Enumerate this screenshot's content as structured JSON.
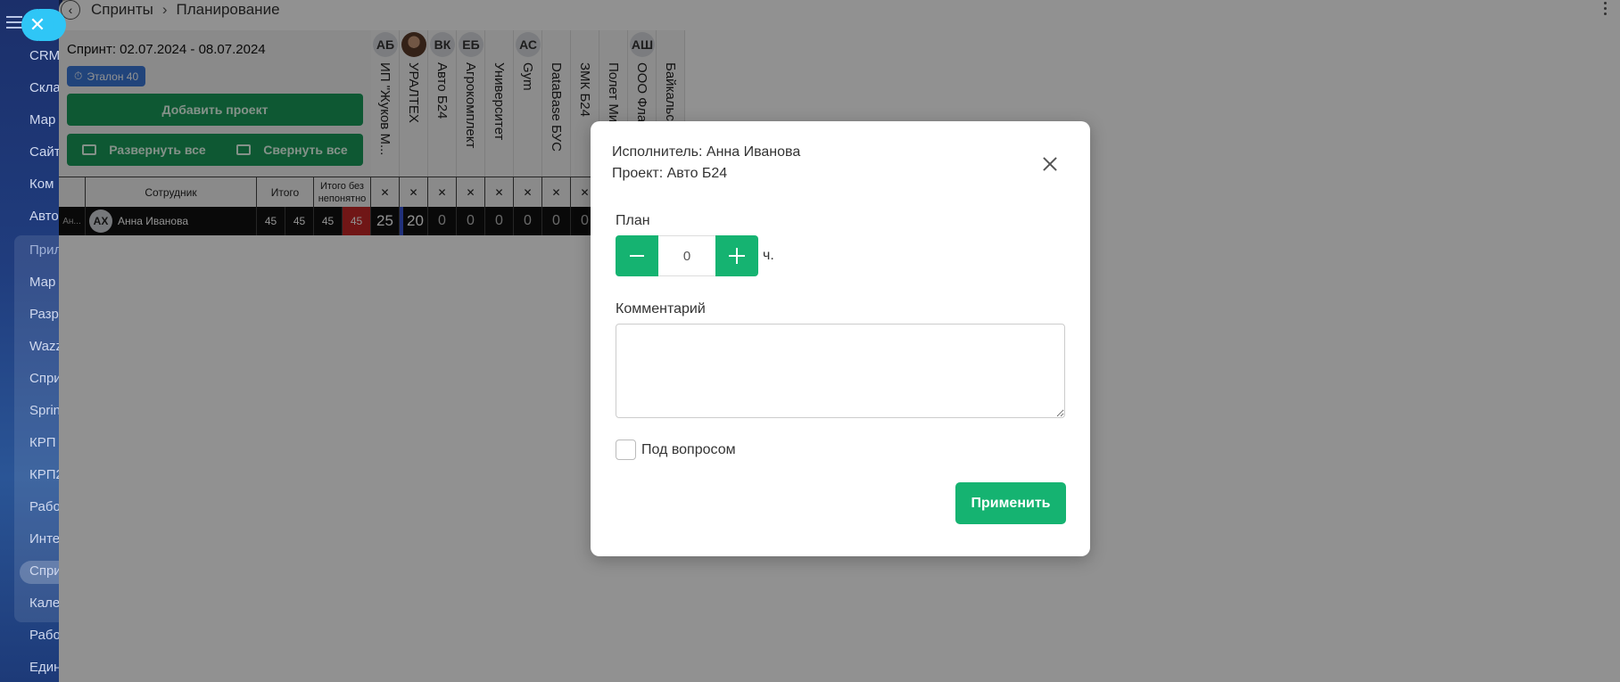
{
  "nav": {
    "items": [
      "CRM",
      "Скла",
      "Мар",
      "Сайт",
      "Ком",
      "Авто",
      "Прил",
      "Мар",
      "Разр",
      "Wazz",
      "Спри",
      "Sprin",
      "КРП",
      "КРП2",
      "Рабо",
      "Инте",
      "Спри",
      "Кале",
      "Рабо",
      "Един"
    ]
  },
  "header": {
    "crumb_1": "Спринты",
    "crumb_2": "Планирование"
  },
  "sprint": {
    "title": "Спринт: 02.07.2024 - 08.07.2024",
    "badge": "Эталон 40",
    "add_project": "Добавить проект",
    "expand_all": "Развернуть все",
    "collapse_all": "Свернуть все"
  },
  "projects": [
    {
      "avatar": "АБ",
      "name": "ИП \"Жуков М...",
      "photo": false
    },
    {
      "avatar": "",
      "name": "УРАЛТЕХ",
      "photo": true
    },
    {
      "avatar": "ВК",
      "name": "Авто Б24",
      "photo": false
    },
    {
      "avatar": "ЕБ",
      "name": "Агрокомплект",
      "photo": false
    },
    {
      "avatar": "",
      "name": "Университет",
      "photo": false
    },
    {
      "avatar": "АС",
      "name": "Gym",
      "photo": false
    },
    {
      "avatar": "",
      "name": "DataBase БУС",
      "photo": false
    },
    {
      "avatar": "",
      "name": "ЗМК Б24",
      "photo": false
    },
    {
      "avatar": "",
      "name": "Полет Ми",
      "photo": false
    },
    {
      "avatar": "АШ",
      "name": "ООО Фла",
      "photo": false
    },
    {
      "avatar": "",
      "name": "Байкальс",
      "photo": false
    }
  ],
  "table": {
    "col_employee": "Сотрудник",
    "col_total": "Итого",
    "col_total_unclear": "Итого без непонятно",
    "row": {
      "side": "Ан...",
      "avatar": "АХ",
      "name": "Анна Иванова",
      "totals": [
        "45",
        "45",
        "45",
        "45"
      ],
      "cells": [
        "25",
        "20",
        "0",
        "0",
        "0",
        "0",
        "0",
        "0"
      ]
    },
    "x_mark": "✕"
  },
  "modal": {
    "executor": "Исполнитель: Анна Иванова",
    "project": "Проект: Авто Б24",
    "plan_label": "План",
    "plan_value": "0",
    "unit": "ч.",
    "comment_label": "Комментарий",
    "question_label": "Под вопросом",
    "apply_button": "Применить"
  }
}
